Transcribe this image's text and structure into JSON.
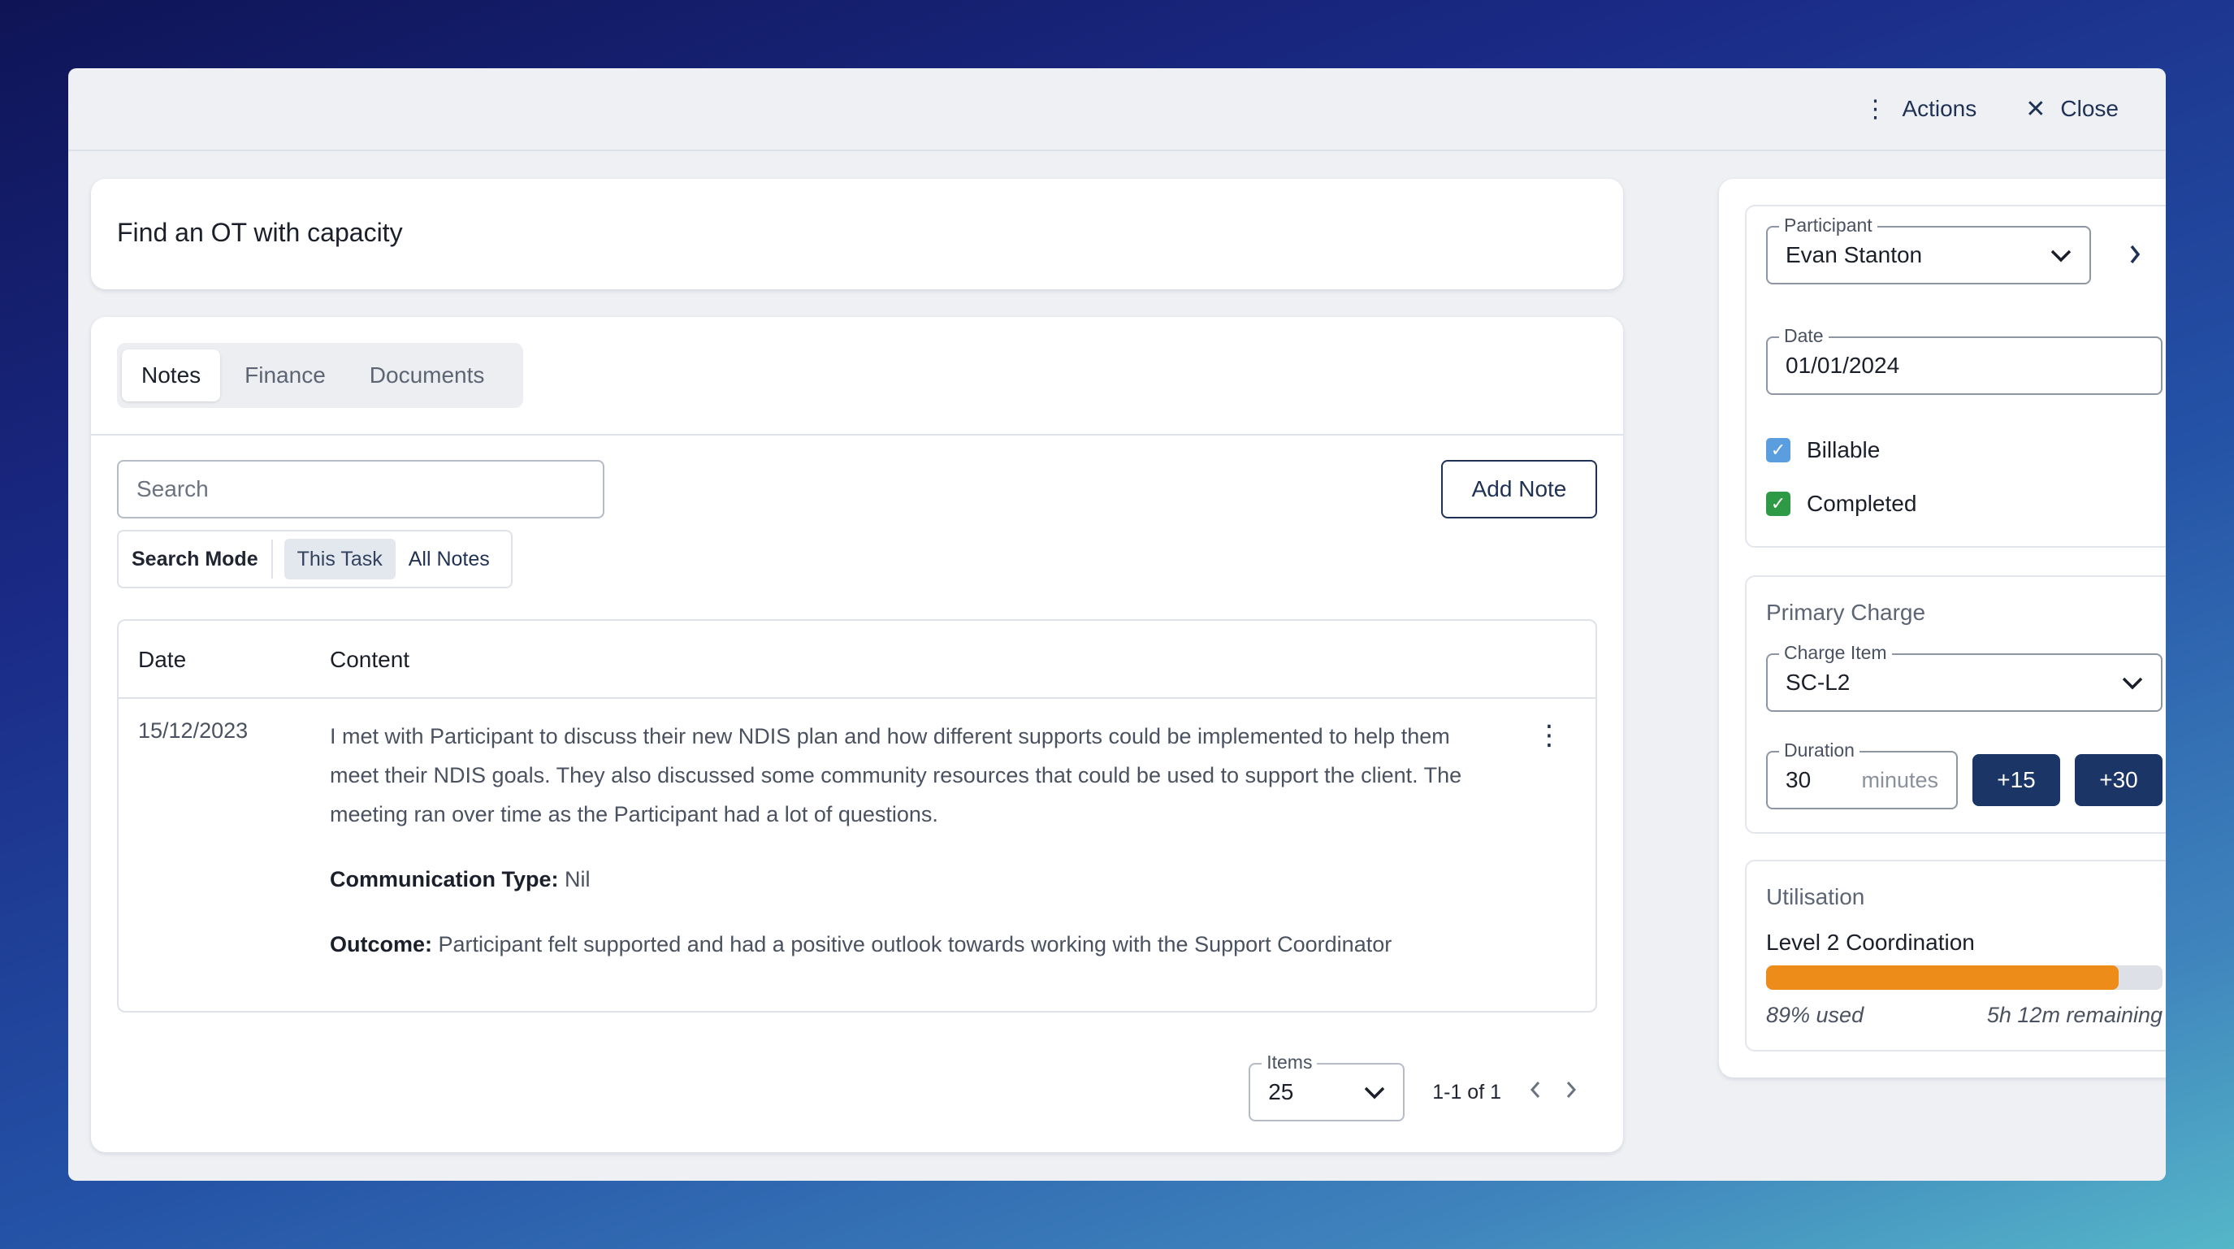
{
  "header": {
    "actions_label": "Actions",
    "close_label": "Close"
  },
  "task": {
    "title": "Find an OT with capacity"
  },
  "tabs": [
    {
      "label": "Notes",
      "active": true
    },
    {
      "label": "Finance",
      "active": false
    },
    {
      "label": "Documents",
      "active": false
    }
  ],
  "notes": {
    "search_placeholder": "Search",
    "add_note_label": "Add Note",
    "search_mode": {
      "label": "Search Mode",
      "options": [
        {
          "label": "This Task",
          "active": true
        },
        {
          "label": "All Notes",
          "active": false
        }
      ]
    },
    "table": {
      "columns": [
        "Date",
        "Content"
      ],
      "rows": [
        {
          "date": "15/12/2023",
          "text": "I met with Participant to discuss their new NDIS plan and how different supports could be implemented to help them meet their NDIS goals. They also discussed some community resources that could be used to support the client. The meeting ran over time as the Participant had a lot of questions.",
          "comm_type_label": "Communication Type:",
          "comm_type_value": "Nil",
          "outcome_label": "Outcome:",
          "outcome_value": "Participant felt supported and had a positive outlook towards working with the Support Coordinator"
        }
      ]
    },
    "pagination": {
      "items_label": "Items",
      "items_value": "25",
      "range": "1-1 of 1"
    }
  },
  "sidebar": {
    "participant": {
      "label": "Participant",
      "value": "Evan Stanton"
    },
    "date": {
      "label": "Date",
      "value": "01/01/2024"
    },
    "billable": {
      "label": "Billable",
      "checked": true,
      "color": "#5b9ee0"
    },
    "completed": {
      "label": "Completed",
      "checked": true,
      "color": "#2f9a46"
    },
    "primary_charge": {
      "title": "Primary Charge",
      "charge_item_label": "Charge Item",
      "charge_item_value": "SC-L2",
      "duration_label": "Duration",
      "duration_value": "30",
      "duration_unit": "minutes",
      "quick_add": [
        "+15",
        "+30"
      ]
    },
    "utilisation": {
      "title": "Utilisation",
      "item": "Level 2 Coordination",
      "used_fraction": 0.89,
      "used_text": "89% used",
      "remaining_text": "5h 12m remaining",
      "bar_color": "#ee8c1a"
    }
  }
}
